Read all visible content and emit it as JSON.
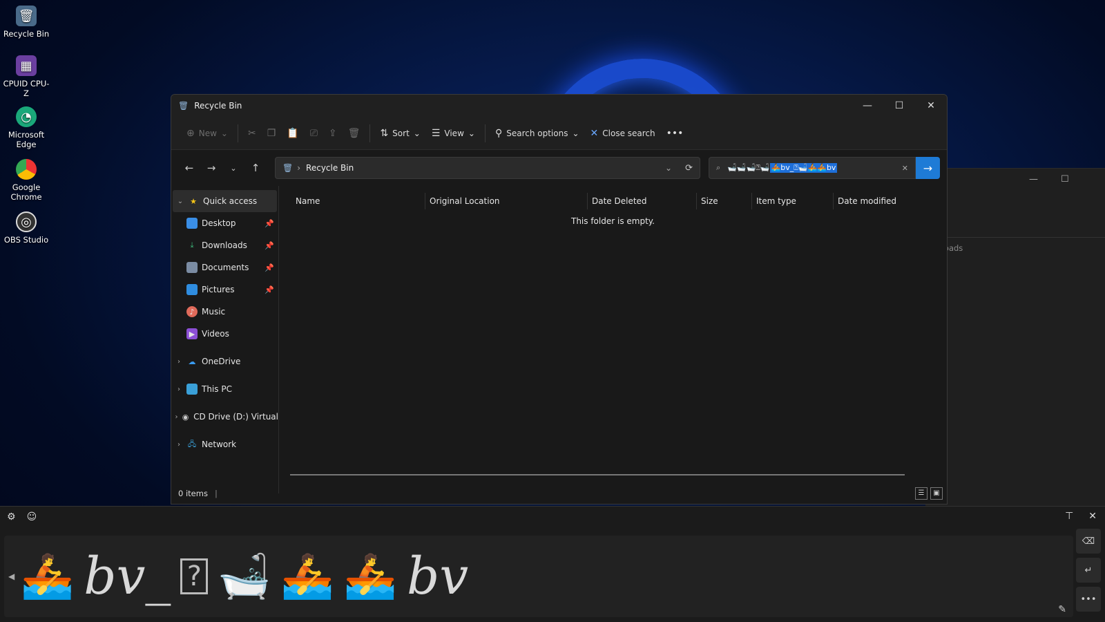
{
  "desktop": {
    "icons": [
      {
        "label": "Recycle Bin",
        "icon": "recycle-bin-icon"
      },
      {
        "label": "CPUID CPU-Z",
        "icon": "cpuz-icon"
      },
      {
        "label": "Microsoft Edge",
        "icon": "edge-icon"
      },
      {
        "label": "Google Chrome",
        "icon": "chrome-icon"
      },
      {
        "label": "OBS Studio",
        "icon": "obs-icon"
      }
    ]
  },
  "background_window": {
    "address_fragment": "ownloads"
  },
  "window": {
    "title": "Recycle Bin",
    "toolbar": {
      "new_label": "New",
      "sort_label": "Sort",
      "view_label": "View",
      "search_options_label": "Search options",
      "close_search_label": "Close search"
    },
    "address": {
      "path": "Recycle Bin"
    },
    "search": {
      "text_plain": "🛁🛁🛁⍰🛁",
      "text_selected": "🚣bv_⍰🛁🚣🚣bv"
    },
    "nav": {
      "quick_access": "Quick access",
      "items": [
        "Desktop",
        "Downloads",
        "Documents",
        "Pictures",
        "Music",
        "Videos"
      ],
      "onedrive": "OneDrive",
      "this_pc": "This PC",
      "cd_drive": "CD Drive (D:) Virtual",
      "network": "Network"
    },
    "columns": [
      "Name",
      "Original Location",
      "Date Deleted",
      "Size",
      "Item type",
      "Date modified"
    ],
    "empty_message": "This folder is empty.",
    "status": "0 items"
  },
  "handwriting": {
    "ink_1": "bv_",
    "ink_2": "bv"
  }
}
